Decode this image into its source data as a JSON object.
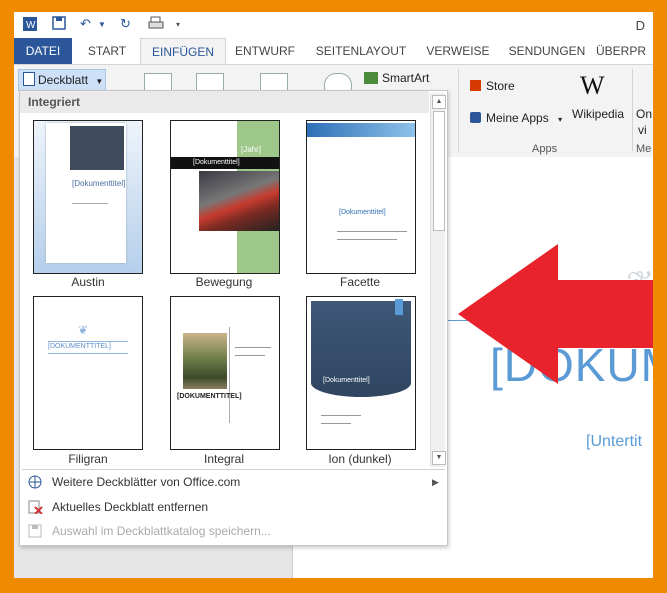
{
  "window": {
    "title_fragment": "D"
  },
  "qat": {
    "word_icon": "word-icon",
    "save_icon": "save-icon",
    "undo_icon": "undo-icon",
    "redo_icon": "redo-icon",
    "print_icon": "print-icon"
  },
  "tabs": [
    {
      "label": "DATEI"
    },
    {
      "label": "START"
    },
    {
      "label": "EINFÜGEN"
    },
    {
      "label": "ENTWURF"
    },
    {
      "label": "SEITENLAYOUT"
    },
    {
      "label": "VERWEISE"
    },
    {
      "label": "SENDUNGEN"
    },
    {
      "label": "ÜBERPR"
    }
  ],
  "ribbon": {
    "deckblatt_label": "Deckblatt",
    "smartart_label": "SmartArt",
    "store_label": "Store",
    "meine_apps_label": "Meine Apps",
    "wikipedia_label": "Wikipedia",
    "wiki_logo": "W",
    "apps_group_label": "Apps",
    "on_label": "On",
    "vi_label": "vi",
    "me_label": "Me"
  },
  "gallery": {
    "header": "Integriert",
    "tiles": [
      {
        "label": "Austin",
        "text": "[Dokumenttitel]"
      },
      {
        "label": "Bewegung",
        "text": "[Dokumenttitel]",
        "year": "[Jahr]"
      },
      {
        "label": "Facette",
        "text": "[Dokumenttitel]"
      },
      {
        "label": "Filigran",
        "text": "[DOKUMENTTITEL]"
      },
      {
        "label": "Integral",
        "text": "[DOKUMENTTITEL]"
      },
      {
        "label": "Ion (dunkel)",
        "text": "[Dokumenttitel]"
      }
    ],
    "menu": [
      {
        "label": "Weitere Deckblätter von Office.com",
        "enabled": true
      },
      {
        "label": "Aktuelles Deckblatt entfernen",
        "enabled": true
      },
      {
        "label": "Auswahl im Deckblattkatalog speichern...",
        "enabled": false
      }
    ]
  },
  "document": {
    "title": "[DOKUM",
    "subtitle": "[Untertit"
  },
  "colors": {
    "border": "#f08a00",
    "word_blue": "#2b579a",
    "doc_accent": "#5b9bd5",
    "arrow_red": "#e8232b"
  }
}
